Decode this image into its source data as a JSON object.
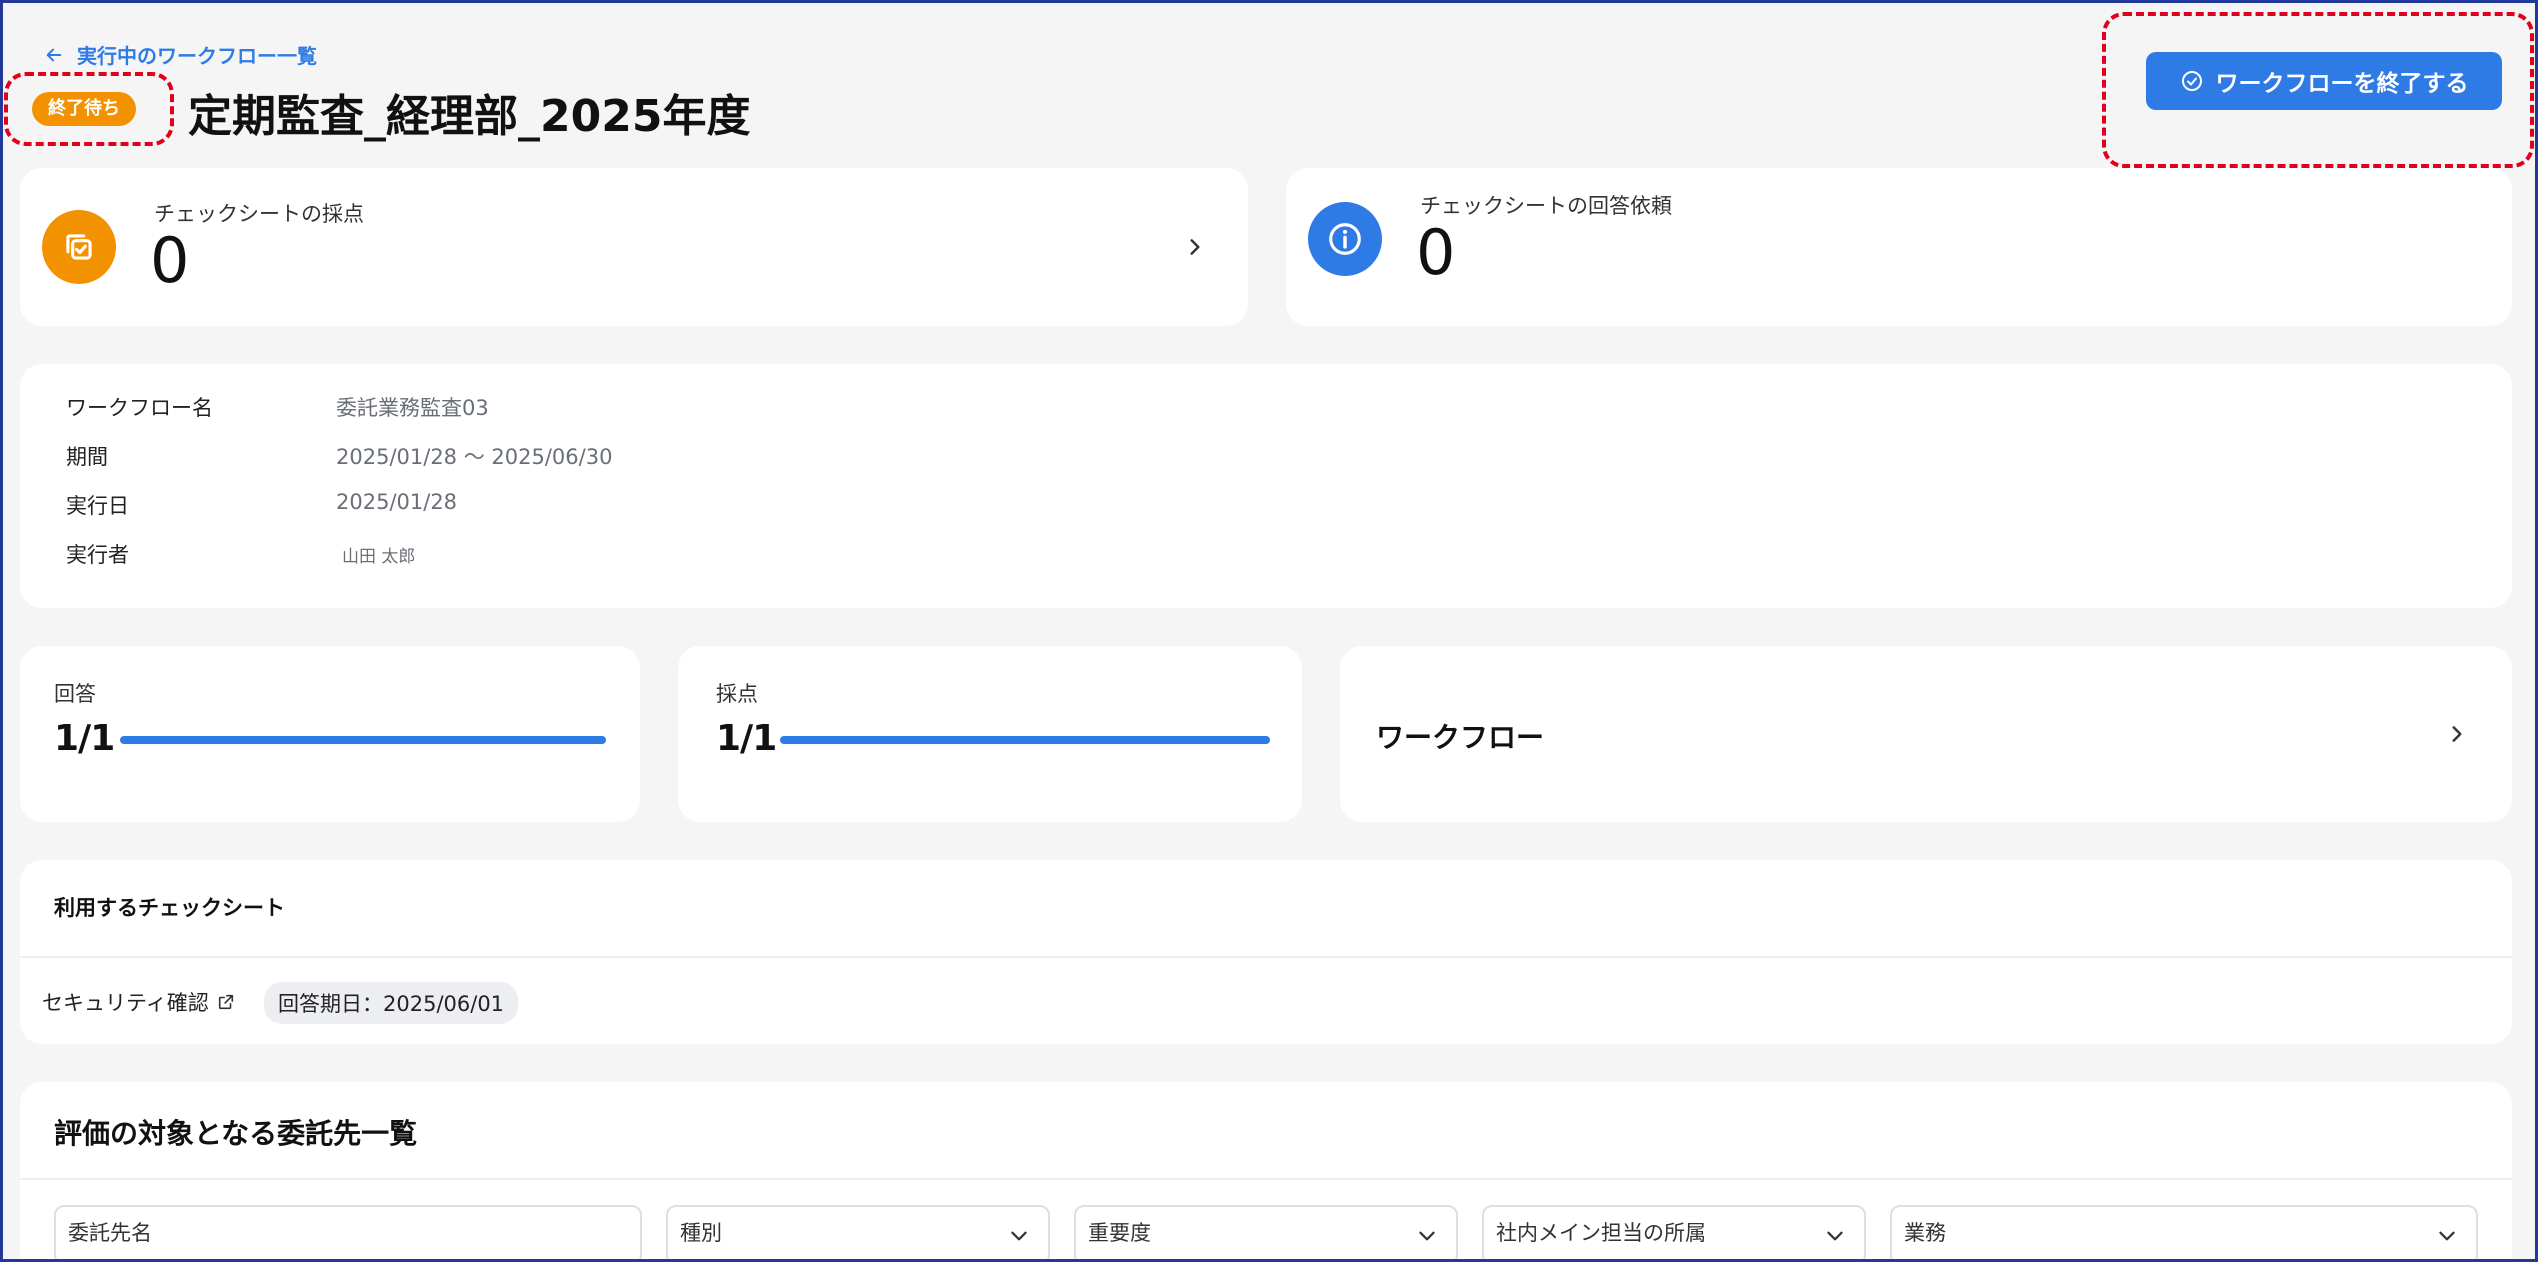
{
  "header": {
    "back_link": "実行中のワークフロー一覧",
    "status_badge": "終了待ち",
    "title": "定期監査_経理部_2025年度",
    "end_button": "ワークフローを終了する"
  },
  "stats": [
    {
      "label": "チェックシートの採点",
      "value": "0",
      "icon": "copy-check-icon",
      "color": "#f39200"
    },
    {
      "label": "チェックシートの回答依頼",
      "value": "0",
      "icon": "info-icon",
      "color": "#2f7be6"
    }
  ],
  "info": [
    {
      "key": "ワークフロー名",
      "value": "委託業務監査03"
    },
    {
      "key": "期間",
      "value": "2025/01/28 〜 2025/06/30"
    },
    {
      "key": "実行日",
      "value": "2025/01/28"
    },
    {
      "key": "実行者",
      "value": "山田 太郎"
    }
  ],
  "progress": [
    {
      "label": "回答",
      "value": "1/1",
      "ratio": 1.0
    },
    {
      "label": "採点",
      "value": "1/1",
      "ratio": 1.0
    }
  ],
  "workflow_card": {
    "label": "ワークフロー"
  },
  "checksheets": {
    "title": "利用するチェックシート",
    "items": [
      {
        "name": "セキュリティ確認",
        "due": "回答期日：2025/06/01"
      }
    ]
  },
  "vendors": {
    "title": "評価の対象となる委託先一覧",
    "filters": [
      "委託先名",
      "種別",
      "重要度",
      "社内メイン担当の所属",
      "業務"
    ]
  },
  "colors": {
    "accent": "#2f7be6",
    "warning": "#f39200",
    "highlight": "#e0001b"
  }
}
